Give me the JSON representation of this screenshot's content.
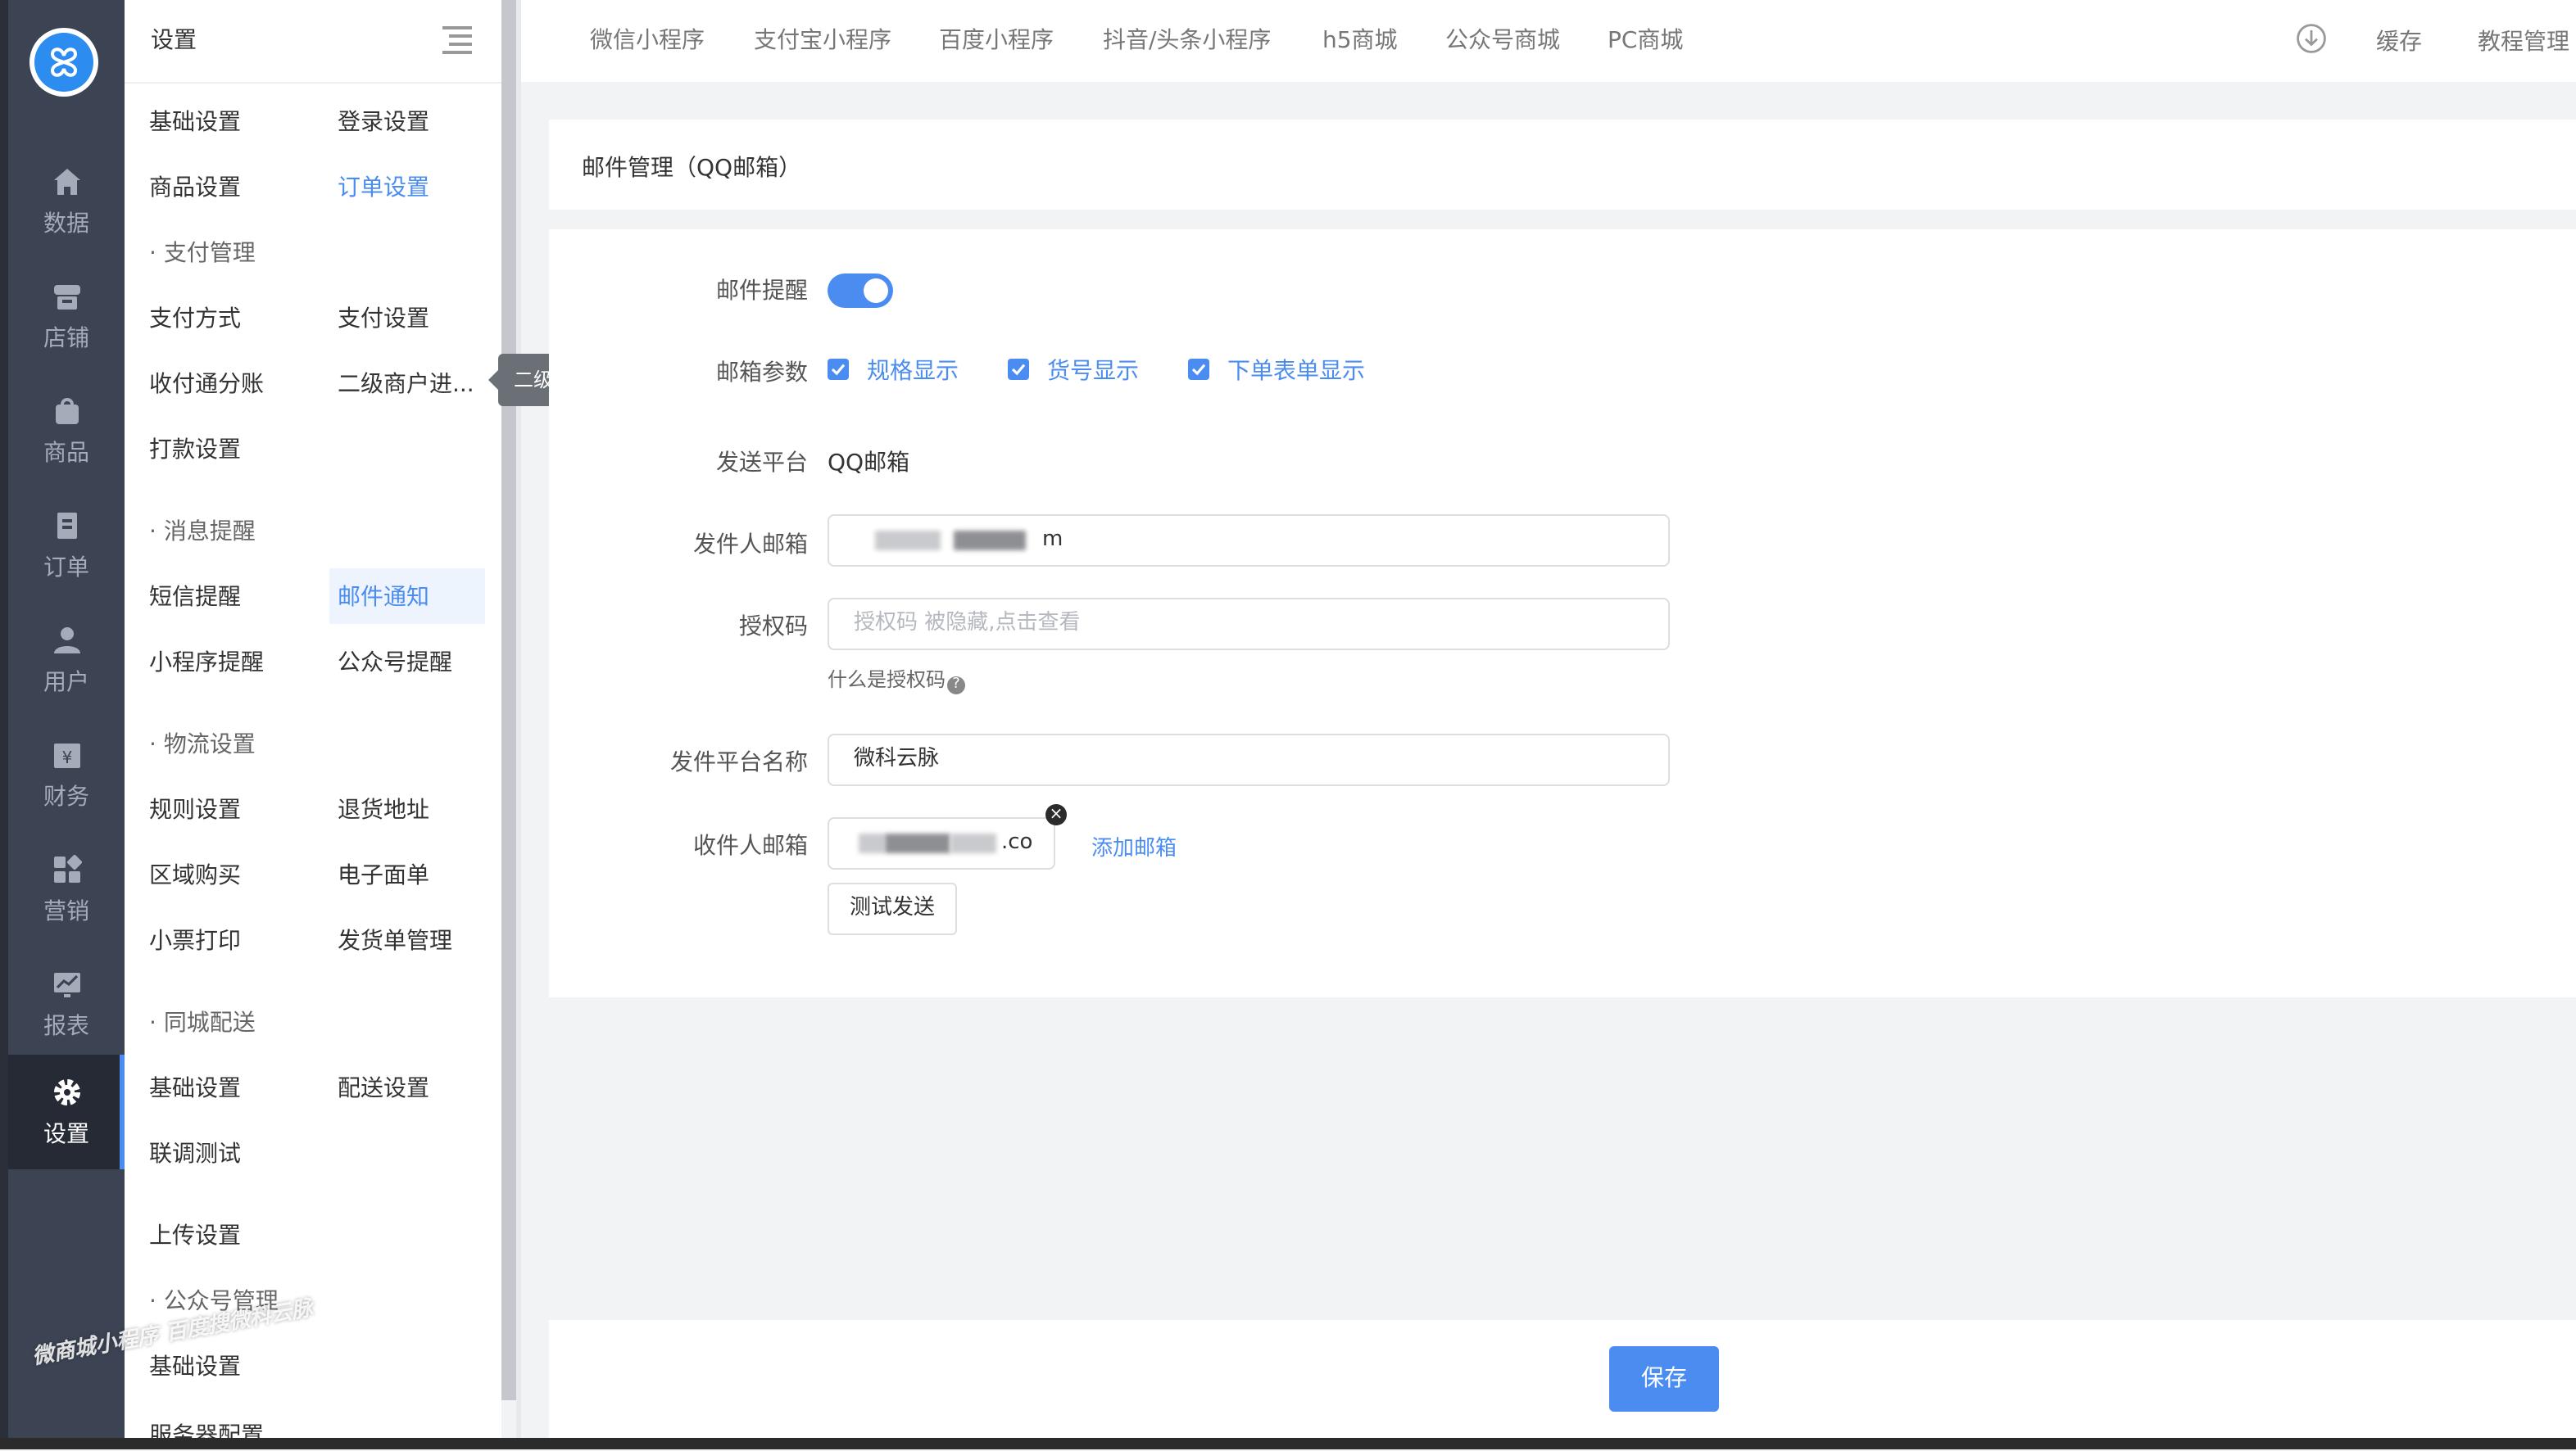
{
  "rail": {
    "items": [
      {
        "label": "数据",
        "icon": "home-icon"
      },
      {
        "label": "店铺",
        "icon": "store-icon"
      },
      {
        "label": "商品",
        "icon": "bag-icon"
      },
      {
        "label": "订单",
        "icon": "order-icon"
      },
      {
        "label": "用户",
        "icon": "user-icon"
      },
      {
        "label": "财务",
        "icon": "finance-icon"
      },
      {
        "label": "营销",
        "icon": "marketing-icon"
      },
      {
        "label": "报表",
        "icon": "report-icon"
      },
      {
        "label": "设置",
        "icon": "gear-icon",
        "active": true
      }
    ]
  },
  "submenu": {
    "title": "设置",
    "basic_settings": "基础设置",
    "login_settings": "登录设置",
    "product_settings": "商品设置",
    "order_settings": "订单设置",
    "group_payment": "支付管理",
    "payment_method": "支付方式",
    "payment_settings": "支付设置",
    "split_account": "收付通分账",
    "sub_merchant": "二级商户进...",
    "payout_settings": "打款设置",
    "group_message": "消息提醒",
    "sms_reminder": "短信提醒",
    "email_notice": "邮件通知",
    "miniapp_reminder": "小程序提醒",
    "official_reminder": "公众号提醒",
    "group_logistics": "物流设置",
    "rule_settings": "规则设置",
    "return_address": "退货地址",
    "region_purchase": "区域购买",
    "e_waybill": "电子面单",
    "receipt_print": "小票打印",
    "shipping_doc": "发货单管理",
    "group_local": "同城配送",
    "local_basic": "基础设置",
    "delivery_settings": "配送设置",
    "joint_test": "联调测试",
    "upload_settings": "上传设置",
    "group_official": "公众号管理",
    "official_basic": "基础设置",
    "server_config": "服务器配置"
  },
  "tooltip": "二级商户进件管理",
  "watermark": "微商城小程序  百度搜微科云脉",
  "topbar": {
    "tabs": [
      "微信小程序",
      "支付宝小程序",
      "百度小程序",
      "抖音/头条小程序",
      "h5商城",
      "公众号商城",
      "PC商城"
    ],
    "cache": "缓存",
    "tutorial": "教程管理"
  },
  "page": {
    "title": "邮件管理（QQ邮箱）",
    "save": "保存"
  },
  "form": {
    "email_reminder_label": "邮件提醒",
    "email_reminder_on": true,
    "email_params_label": "邮箱参数",
    "params": [
      "规格显示",
      "货号显示",
      "下单表单显示"
    ],
    "platform_label": "发送平台",
    "platform_value": "QQ邮箱",
    "sender_label": "发件人邮箱",
    "sender_suffix": "m",
    "auth_label": "授权码",
    "auth_placeholder": "授权码 被隐藏,点击查看",
    "auth_hint": "什么是授权码",
    "platform_name_label": "发件平台名称",
    "platform_name_value": "微科云脉",
    "receiver_label": "收件人邮箱",
    "receiver_suffix": ".co",
    "add_email": "添加邮箱",
    "test_send": "测试发送"
  }
}
